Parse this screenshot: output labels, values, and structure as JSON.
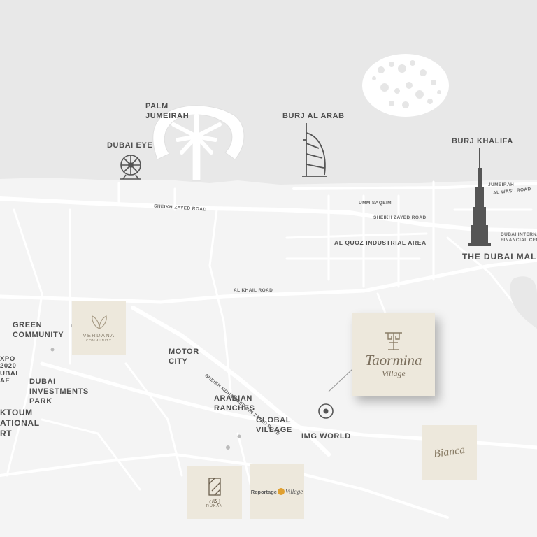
{
  "landmarks": {
    "palm_jumeirah": "PALM\nJUMEIRAH",
    "dubai_eye": "DUBAI EYE",
    "burj_al_arab": "BURJ AL ARAB",
    "burj_khalifa": "BURJ KHALIFA",
    "dubai_mall": "THE DUBAI MAL"
  },
  "areas": {
    "al_quoz": "AL QUOZ INDUSTRIAL AREA",
    "green_community": "GREEN\nCOMMUNITY",
    "motor_city": "MOTOR\nCITY",
    "dubai_investments_park": "DUBAI\nINVESTMENTS\nPARK",
    "arabian_ranches": "ARABIAN\nRANCHES",
    "global_village": "GLOBAL\nVILLAGE",
    "img_world": "IMG WORLD",
    "expo": "XPO\n2020\nUBAI\nAE",
    "maktoum": "KTOUM\nATIONAL\nRT"
  },
  "roads": {
    "sheikh_zayed_left": "SHEIKH ZAYED ROAD",
    "sheikh_zayed_right": "SHEIKH ZAYED ROAD",
    "umm_suqeim": "UMM SAQEIM",
    "jumeirah": "JUMEIRAH",
    "al_wasl": "AL WASL ROAD",
    "al_khail": "AL KHAIL ROAD",
    "sheikh_mohammed": "SHEIKH MOHAMMED BIN ZAYED ROAD",
    "difc": "DUBAI INTERNATI\nFINANCIAL CENTE"
  },
  "projects": {
    "taormina_title": "Taormina",
    "taormina_sub": "Village",
    "verdana_title": "VERDANA",
    "verdana_sub": "COMMUNITY",
    "bianca": "Bianca",
    "rukan_ar": "رُكان",
    "rukan": "RUKAN",
    "reportage": "Reportage",
    "reportage_village": "Village"
  },
  "colors": {
    "sea": "#e8e8e8",
    "land": "#f4f4f4",
    "road": "#ffffff",
    "icon": "#555555",
    "card": "#ede8dc",
    "brand_text": "#7a6e5c",
    "reportage_accent": "#e0a030"
  }
}
